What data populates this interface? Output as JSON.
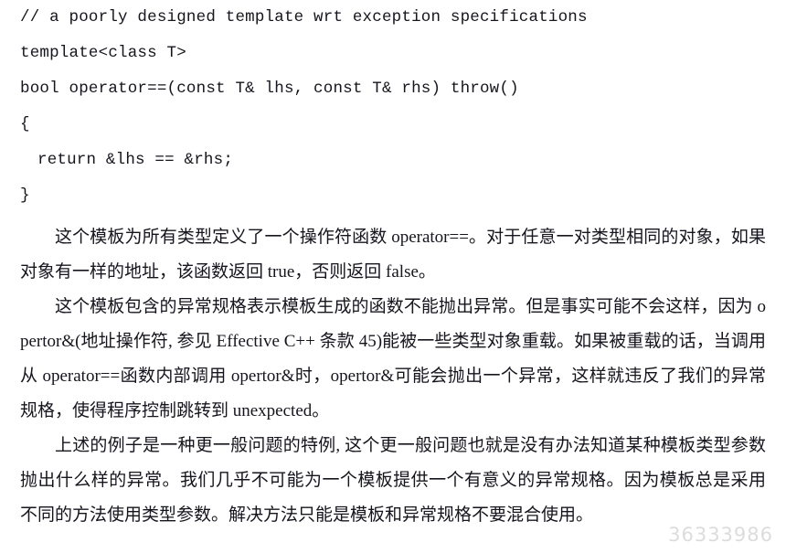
{
  "document": {
    "type": "book-page-scan",
    "language": "zh-CN",
    "background_color": "#ffffff",
    "text_color": "#15151d"
  },
  "code_block": {
    "language": "cpp",
    "lines": [
      {
        "text": "// a poorly designed template wrt exception specifications",
        "indent": 0
      },
      {
        "text": "template<class T>",
        "indent": 0
      },
      {
        "text": "bool operator==(const T& lhs, const T& rhs) throw()",
        "indent": 0
      },
      {
        "text": "{",
        "indent": 0
      },
      {
        "text": "return &lhs == &rhs;",
        "indent": 1
      },
      {
        "text": "}",
        "indent": 0
      }
    ]
  },
  "paragraphs": [
    {
      "id": "p1",
      "text": "这个模板为所有类型定义了一个操作符函数 operator==。对于任意一对类型相同的对象，如果对象有一样的地址，该函数返回 true，否则返回 false。"
    },
    {
      "id": "p2",
      "text": "这个模板包含的异常规格表示模板生成的函数不能抛出异常。但是事实可能不会这样，因为 opertor&(地址操作符, 参见 Effective C++ 条款 45)能被一些类型对象重载。如果被重载的话，当调用从 operator==函数内部调用 opertor&时，opertor&可能会抛出一个异常，这样就违反了我们的异常规格，使得程序控制跳转到 unexpected。"
    },
    {
      "id": "p3",
      "text": "上述的例子是一种更一般问题的特例, 这个更一般问题也就是没有办法知道某种模板类型参数抛出什么样的异常。我们几乎不可能为一个模板提供一个有意义的异常规格。因为模板总是采用不同的方法使用类型参数。解决方法只能是模板和异常规格不要混合使用。"
    }
  ],
  "watermark": {
    "text": "36333986",
    "color": "#dcdcdc"
  }
}
